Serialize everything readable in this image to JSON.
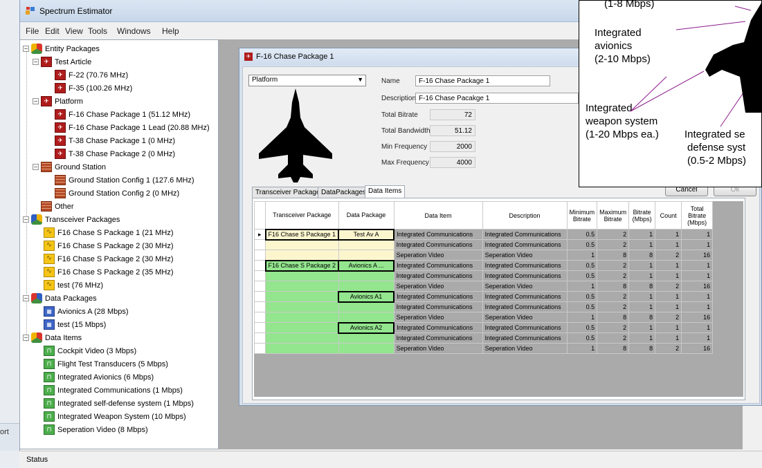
{
  "window": {
    "title": "Spectrum Estimator"
  },
  "menu": [
    "File",
    "Edit",
    "View",
    "Tools",
    "Windows",
    "Help"
  ],
  "tree": {
    "entity_packages": "Entity Packages",
    "test_article": "Test Article",
    "test_article_items": [
      "F-22 (70.76 MHz)",
      "F-35 (100.26 MHz)"
    ],
    "platform": "Platform",
    "platform_items": [
      "F-16 Chase Package 1 (51.12 MHz)",
      "F-16 Chase Package 1 Lead (20.88 MHz)",
      "T-38 Chase Package 1 (0 MHz)",
      "T-38 Chase Package 2 (0 MHz)"
    ],
    "ground_station": "Ground Station",
    "ground_items": [
      "Ground Station Config 1 (127.6 MHz)",
      "Ground Station Config 2 (0 MHz)"
    ],
    "other": "Other",
    "transceiver_packages": "Transceiver Packages",
    "transceiver_items": [
      "F16 Chase S  Package 1 (21 MHz)",
      "F16 Chase S  Package 2 (30 MHz)",
      "F16 Chase S  Package 2 (30 MHz)",
      "F16 Chase S  Package 2 (35 MHz)",
      "test (76 MHz)"
    ],
    "data_packages": "Data Packages",
    "data_package_items": [
      "Avionics A (28 Mbps)",
      "test (15 Mbps)"
    ],
    "data_items": "Data Items",
    "data_item_items": [
      "Cockpit Video (3 Mbps)",
      "Flight Test Transducers (5 Mbps)",
      "Integrated Avionics (6 Mbps)",
      "Integrated Communications (1 Mbps)",
      "Integrated self-defense system (1 Mbps)",
      "Integrated Weapon System (10 Mbps)",
      "Seperation Video (8 Mbps)"
    ]
  },
  "child": {
    "title": "F-16 Chase Package 1",
    "platform_select": "Platform",
    "fields": {
      "name_label": "Name",
      "name_value": "F-16 Chase Package 1",
      "desc_label": "Description",
      "desc_value": "F-16 Chase Pacakge 1",
      "bitrate_label": "Total Bitrate",
      "bitrate_value": "72",
      "bandwidth_label": "Total Bandwidth",
      "bandwidth_value": "51.12",
      "minfreq_label": "Min Frequency",
      "minfreq_value": "2000",
      "maxfreq_label": "Max Frequency",
      "maxfreq_value": "4000"
    },
    "tabs": [
      "Transceiver Packages",
      "DataPackages",
      "Data Items"
    ],
    "cancel": "Cancel",
    "ok": "Ok"
  },
  "grid": {
    "headers": [
      "Transceiver Package",
      "Data Package",
      "Data Item",
      "Description",
      "Minimum Bitrate",
      "Maximum Bitrate",
      "Bitrate (Mbps)",
      "Count",
      "Total Bitrate (Mbps)"
    ],
    "rows": [
      {
        "tp": "F16 Chase S  Package 1",
        "dp": "Test Av A",
        "item": "Integrated Communications",
        "desc": "Integrated Communications",
        "min": "0.5",
        "max": "2",
        "br": "1",
        "cnt": "1",
        "tot": "1"
      },
      {
        "tp": "",
        "dp": "",
        "item": "Integrated Communications",
        "desc": "Integrated Communications",
        "min": "0.5",
        "max": "2",
        "br": "1",
        "cnt": "1",
        "tot": "1"
      },
      {
        "tp": "",
        "dp": "",
        "item": "Seperation Video",
        "desc": "Seperation Video",
        "min": "1",
        "max": "8",
        "br": "8",
        "cnt": "2",
        "tot": "16"
      },
      {
        "tp": "F16 Chase S  Package 2",
        "dp": "Avionics A ...",
        "item": "Integrated Communications",
        "desc": "Integrated Communications",
        "min": "0.5",
        "max": "2",
        "br": "1",
        "cnt": "1",
        "tot": "1"
      },
      {
        "tp": "",
        "dp": "",
        "item": "Integrated Communications",
        "desc": "Integrated Communications",
        "min": "0.5",
        "max": "2",
        "br": "1",
        "cnt": "1",
        "tot": "1"
      },
      {
        "tp": "",
        "dp": "",
        "item": "Seperation Video",
        "desc": "Seperation Video",
        "min": "1",
        "max": "8",
        "br": "8",
        "cnt": "2",
        "tot": "16"
      },
      {
        "tp": "",
        "dp": "Avionics A1",
        "item": "Integrated Communications",
        "desc": "Integrated Communications",
        "min": "0.5",
        "max": "2",
        "br": "1",
        "cnt": "1",
        "tot": "1"
      },
      {
        "tp": "",
        "dp": "",
        "item": "Integrated Communications",
        "desc": "Integrated Communications",
        "min": "0.5",
        "max": "2",
        "br": "1",
        "cnt": "1",
        "tot": "1"
      },
      {
        "tp": "",
        "dp": "",
        "item": "Seperation Video",
        "desc": "Seperation Video",
        "min": "1",
        "max": "8",
        "br": "8",
        "cnt": "2",
        "tot": "16"
      },
      {
        "tp": "",
        "dp": "Avionics A2",
        "item": "Integrated Communications",
        "desc": "Integrated Communications",
        "min": "0.5",
        "max": "2",
        "br": "1",
        "cnt": "1",
        "tot": "1"
      },
      {
        "tp": "",
        "dp": "",
        "item": "Integrated Communications",
        "desc": "Integrated Communications",
        "min": "0.5",
        "max": "2",
        "br": "1",
        "cnt": "1",
        "tot": "1"
      },
      {
        "tp": "",
        "dp": "",
        "item": "Seperation Video",
        "desc": "Seperation Video",
        "min": "1",
        "max": "8",
        "br": "8",
        "cnt": "2",
        "tot": "16"
      }
    ]
  },
  "overlay": {
    "top_text": "(1-8 Mbps)",
    "avionics": [
      "Integrated",
      "avionics",
      "(2-10 Mbps)"
    ],
    "weapon": [
      "Integrated",
      "weapon system",
      "(1-20 Mbps ea.)"
    ],
    "defense": [
      "Integrated se",
      "defense syst",
      "(0.5-2 Mbps)"
    ]
  },
  "status": "Status",
  "outer_fragment": "ort"
}
